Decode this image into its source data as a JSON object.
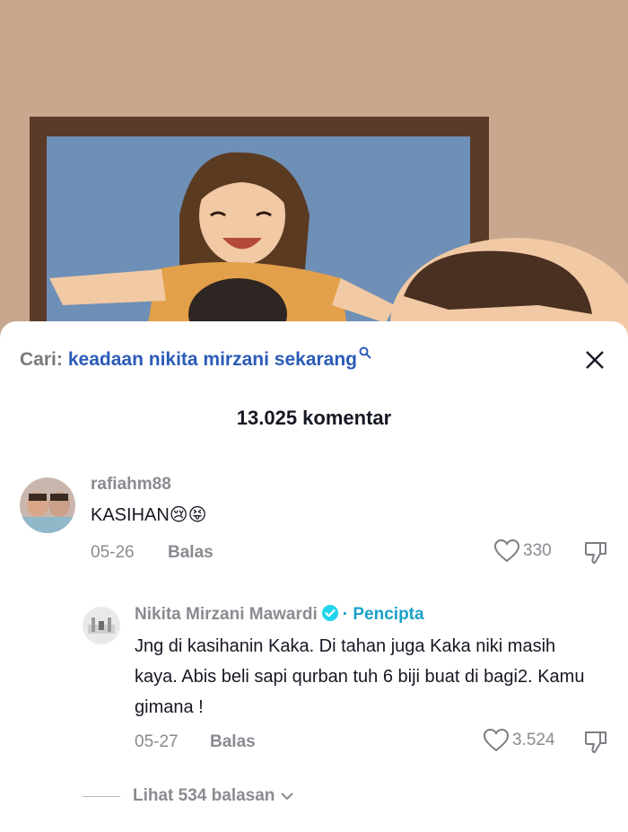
{
  "search": {
    "prefix": "Cari:",
    "term": "keadaan nikita mirzani sekarang"
  },
  "comment_count": "13.025 komentar",
  "comments": [
    {
      "username": "rafiahm88",
      "text": "KASIHAN😢😝",
      "date": "05-26",
      "reply_label": "Balas",
      "likes": "330"
    }
  ],
  "reply": {
    "username": "Nikita Mirzani Mawardi",
    "creator_label": "· Pencipta",
    "text": "Jng di kasihanin Kaka. Di tahan juga Kaka niki masih kaya. Abis beli sapi qurban tuh 6 biji buat di bagi2. Kamu gimana !",
    "date": "05-27",
    "reply_label": "Balas",
    "likes": "3.524"
  },
  "view_replies": "Lihat 534 balasan",
  "colors": {
    "link": "#2b5bb8",
    "creator": "#1aa0c8",
    "muted": "#8a8b91",
    "text": "#161823"
  },
  "icons": [
    "search-icon",
    "close-icon",
    "heart-icon",
    "thumbs-down-icon",
    "verified-icon",
    "chevron-down-icon"
  ]
}
